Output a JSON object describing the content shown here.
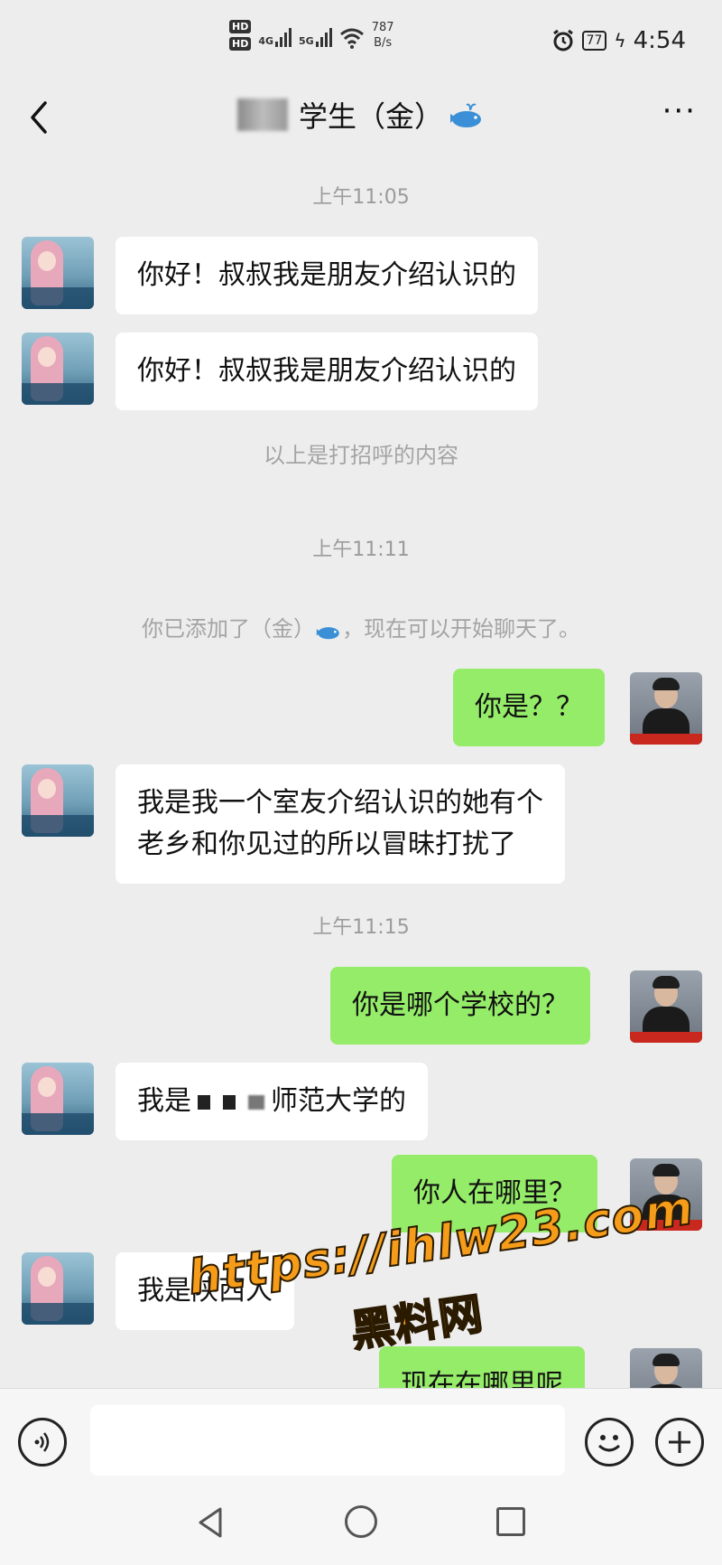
{
  "status_bar": {
    "hd_top": "HD",
    "hd_bottom": "HD",
    "net1": "4G",
    "net2": "5G",
    "speed_value": "787",
    "speed_unit": "B/s",
    "battery": "77",
    "time": "4:54"
  },
  "header": {
    "title": "学生（金）"
  },
  "messages": {
    "time1": "上午11:05",
    "m1": "你好！叔叔我是朋友介绍认识的",
    "m2": "你好！叔叔我是朋友介绍认识的",
    "sys1": "以上是打招呼的内容",
    "time2": "上午11:11",
    "sys2_a": "你已添加了（金）",
    "sys2_b": "，现在可以开始聊天了。",
    "m3": "你是？？",
    "m4_line1": "我是我一个室友介绍认识的她有个",
    "m4_line2": "老乡和你见过的所以冒昧打扰了",
    "time3": "上午11:15",
    "m5": "你是哪个学校的？",
    "m6_prefix": "我是",
    "m6_suffix": "师范大学的",
    "m7": "你人在哪里？",
    "m8": "我是陕西人",
    "m9": "现在在哪里呢"
  },
  "watermark": {
    "line1": "https://ihlw23.com",
    "line2": "黑料网"
  },
  "input_bar": {
    "placeholder": ""
  },
  "icons": {
    "back": "chevron-left-icon",
    "more": "more-icon",
    "voice": "voice-icon",
    "emoji": "emoji-icon",
    "plus": "plus-icon"
  },
  "colors": {
    "background": "#ededed",
    "incoming_bubble": "#ffffff",
    "outgoing_bubble": "#95ec69",
    "timestamp": "#9b9b9b",
    "watermark": "#f59c1a"
  }
}
